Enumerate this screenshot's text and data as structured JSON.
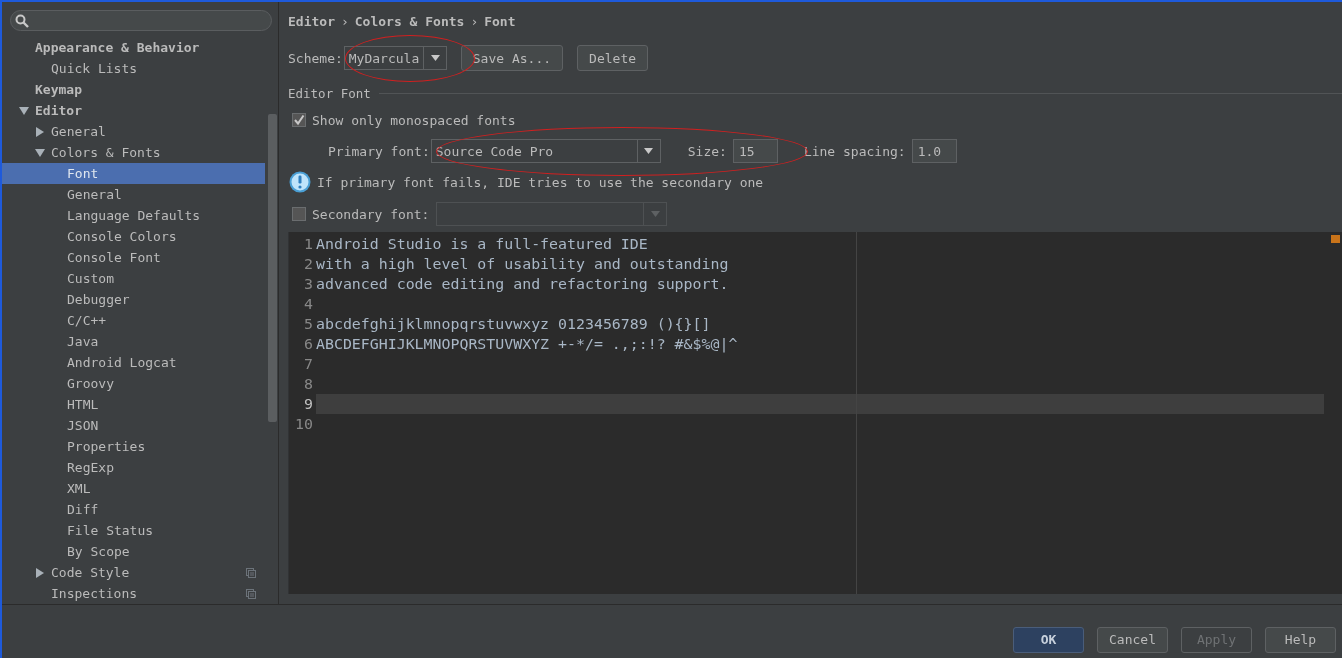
{
  "sidebar": {
    "tree": [
      {
        "label": "Appearance & Behavior",
        "bold": true,
        "children": [
          {
            "label": "Quick Lists",
            "selected": false
          }
        ],
        "selected": false
      },
      {
        "label": "Keymap",
        "bold": true,
        "selected": false
      },
      {
        "label": "Editor",
        "bold": true,
        "expanded": true,
        "selected": false,
        "children": [
          {
            "label": "General",
            "expanded": false,
            "selected": false
          },
          {
            "label": "Colors & Fonts",
            "expanded": true,
            "selected": false,
            "children": [
              {
                "label": "Font",
                "selected": true
              },
              {
                "label": "General",
                "selected": false
              },
              {
                "label": "Language Defaults",
                "selected": false
              },
              {
                "label": "Console Colors",
                "selected": false
              },
              {
                "label": "Console Font",
                "selected": false
              },
              {
                "label": "Custom",
                "selected": false
              },
              {
                "label": "Debugger",
                "selected": false
              },
              {
                "label": "C/C++",
                "selected": false
              },
              {
                "label": "Java",
                "selected": false
              },
              {
                "label": "Android Logcat",
                "selected": false
              },
              {
                "label": "Groovy",
                "selected": false
              },
              {
                "label": "HTML",
                "selected": false
              },
              {
                "label": "JSON",
                "selected": false
              },
              {
                "label": "Properties",
                "selected": false
              },
              {
                "label": "RegExp",
                "selected": false
              },
              {
                "label": "XML",
                "selected": false
              },
              {
                "label": "Diff",
                "selected": false
              },
              {
                "label": "File Status",
                "selected": false
              },
              {
                "label": "By Scope",
                "selected": false
              }
            ]
          },
          {
            "label": "Code Style",
            "expanded": false,
            "selected": false,
            "project_icon": true
          },
          {
            "label": "Inspections",
            "selected": false,
            "project_icon": true
          }
        ]
      }
    ]
  },
  "breadcrumb": {
    "items": [
      "Editor",
      "Colors & Fonts",
      "Font"
    ],
    "separator": "›"
  },
  "scheme": {
    "label": "Scheme:",
    "value": "MyDarcula",
    "buttons": [
      "Save As...",
      "Delete"
    ]
  },
  "editor_font": {
    "title": "Editor Font",
    "monospaced_only": {
      "label": "Show only monospaced fonts",
      "checked": true
    },
    "primary_font": {
      "label": "Primary font:",
      "value": "Source Code Pro"
    },
    "size": {
      "label": "Size:",
      "value": "15"
    },
    "line_spacing": {
      "label": "Line spacing:",
      "value": "1.0"
    },
    "info": "If primary font fails, IDE tries to use the secondary one",
    "secondary_font": {
      "label": "Secondary font:",
      "checked": false,
      "disabled": true
    }
  },
  "preview": {
    "lines": [
      {
        "number": "1",
        "text": "Android Studio is a full-featured IDE",
        "current": false
      },
      {
        "number": "2",
        "text": "with a high level of usability and outstanding",
        "current": false
      },
      {
        "number": "3",
        "text": "advanced code editing and refactoring support.",
        "current": false
      },
      {
        "number": "4",
        "current": false
      },
      {
        "number": "5",
        "text": "abcdefghijklmnopqrstuvwxyz 0123456789 (){}[]",
        "current": false
      },
      {
        "number": "6",
        "text": "ABCDEFGHIJKLMNOPQRSTUVWXYZ +-*/= .,;:!? #&$%@|^",
        "current": false
      },
      {
        "number": "7",
        "current": false
      },
      {
        "number": "8",
        "current": false
      },
      {
        "number": "9",
        "current": true
      },
      {
        "number": "10",
        "current": false
      }
    ]
  },
  "annotations": [
    {
      "kind": "ellipse"
    },
    {
      "kind": "ellipse"
    }
  ],
  "buttons": [
    {
      "label": "OK",
      "kind": "default",
      "disabled": false
    },
    {
      "label": "Cancel",
      "kind": "normal",
      "disabled": false
    },
    {
      "label": "Apply",
      "kind": "normal",
      "disabled": true
    },
    {
      "label": "Help",
      "kind": "normal",
      "disabled": false
    }
  ]
}
